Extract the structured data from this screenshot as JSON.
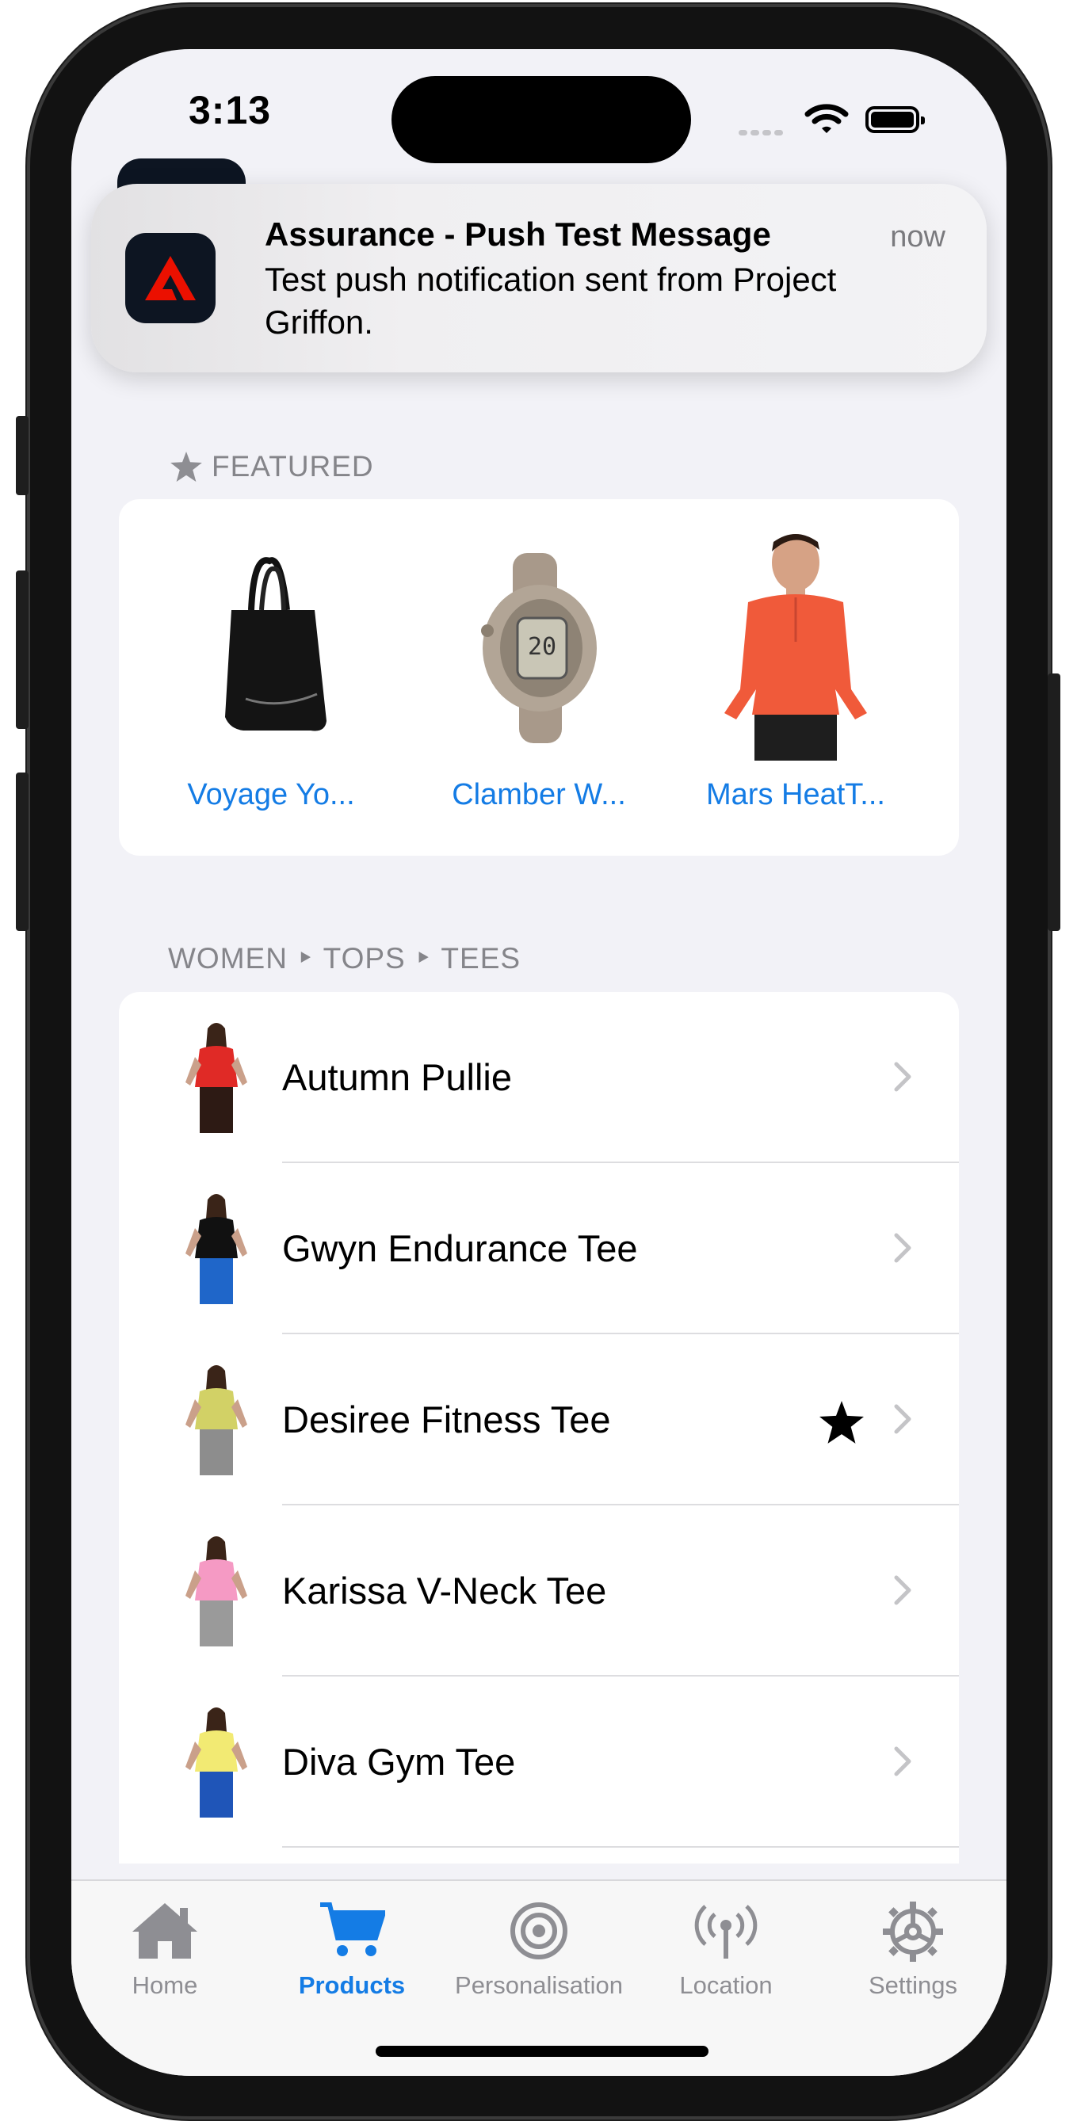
{
  "status_bar": {
    "time": "3:13"
  },
  "notification": {
    "app_icon": "adobe-icon",
    "title": "Assurance - Push Test Message",
    "time": "now",
    "body": "Test push notification sent from Project Griffon."
  },
  "featured": {
    "header": "FEATURED",
    "items": [
      {
        "label": "Voyage Yo...",
        "image": "black-tote-bag"
      },
      {
        "label": "Clamber W...",
        "image": "taupe-sport-watch"
      },
      {
        "label": "Mars HeatT...",
        "image": "man-orange-pullover"
      }
    ]
  },
  "list": {
    "header": "WOMEN ‣ TOPS ‣ TEES",
    "rows": [
      {
        "name": "Autumn Pullie",
        "starred": false,
        "shirt_color": "#e02a26",
        "pants_color": "#2d1a14"
      },
      {
        "name": "Gwyn Endurance Tee",
        "starred": false,
        "shirt_color": "#111111",
        "pants_color": "#1f66c9"
      },
      {
        "name": "Desiree Fitness Tee",
        "starred": true,
        "shirt_color": "#d2d166",
        "pants_color": "#8d8d8d"
      },
      {
        "name": "Karissa V-Neck Tee",
        "starred": false,
        "shirt_color": "#f59ac4",
        "pants_color": "#9a9a9a"
      },
      {
        "name": "Diva Gym Tee",
        "starred": false,
        "shirt_color": "#f2ea73",
        "pants_color": "#1f55b8"
      }
    ]
  },
  "tabs": [
    {
      "label": "Home",
      "icon": "house-icon",
      "active": false
    },
    {
      "label": "Products",
      "icon": "cart-icon",
      "active": true
    },
    {
      "label": "Personalisation",
      "icon": "target-icon",
      "active": false
    },
    {
      "label": "Location",
      "icon": "antenna-icon",
      "active": false
    },
    {
      "label": "Settings",
      "icon": "gear-icon",
      "active": false
    }
  ],
  "colors": {
    "accent": "#147ce5",
    "inactive_tab": "#8e8e93",
    "background": "#f2f2f7"
  }
}
